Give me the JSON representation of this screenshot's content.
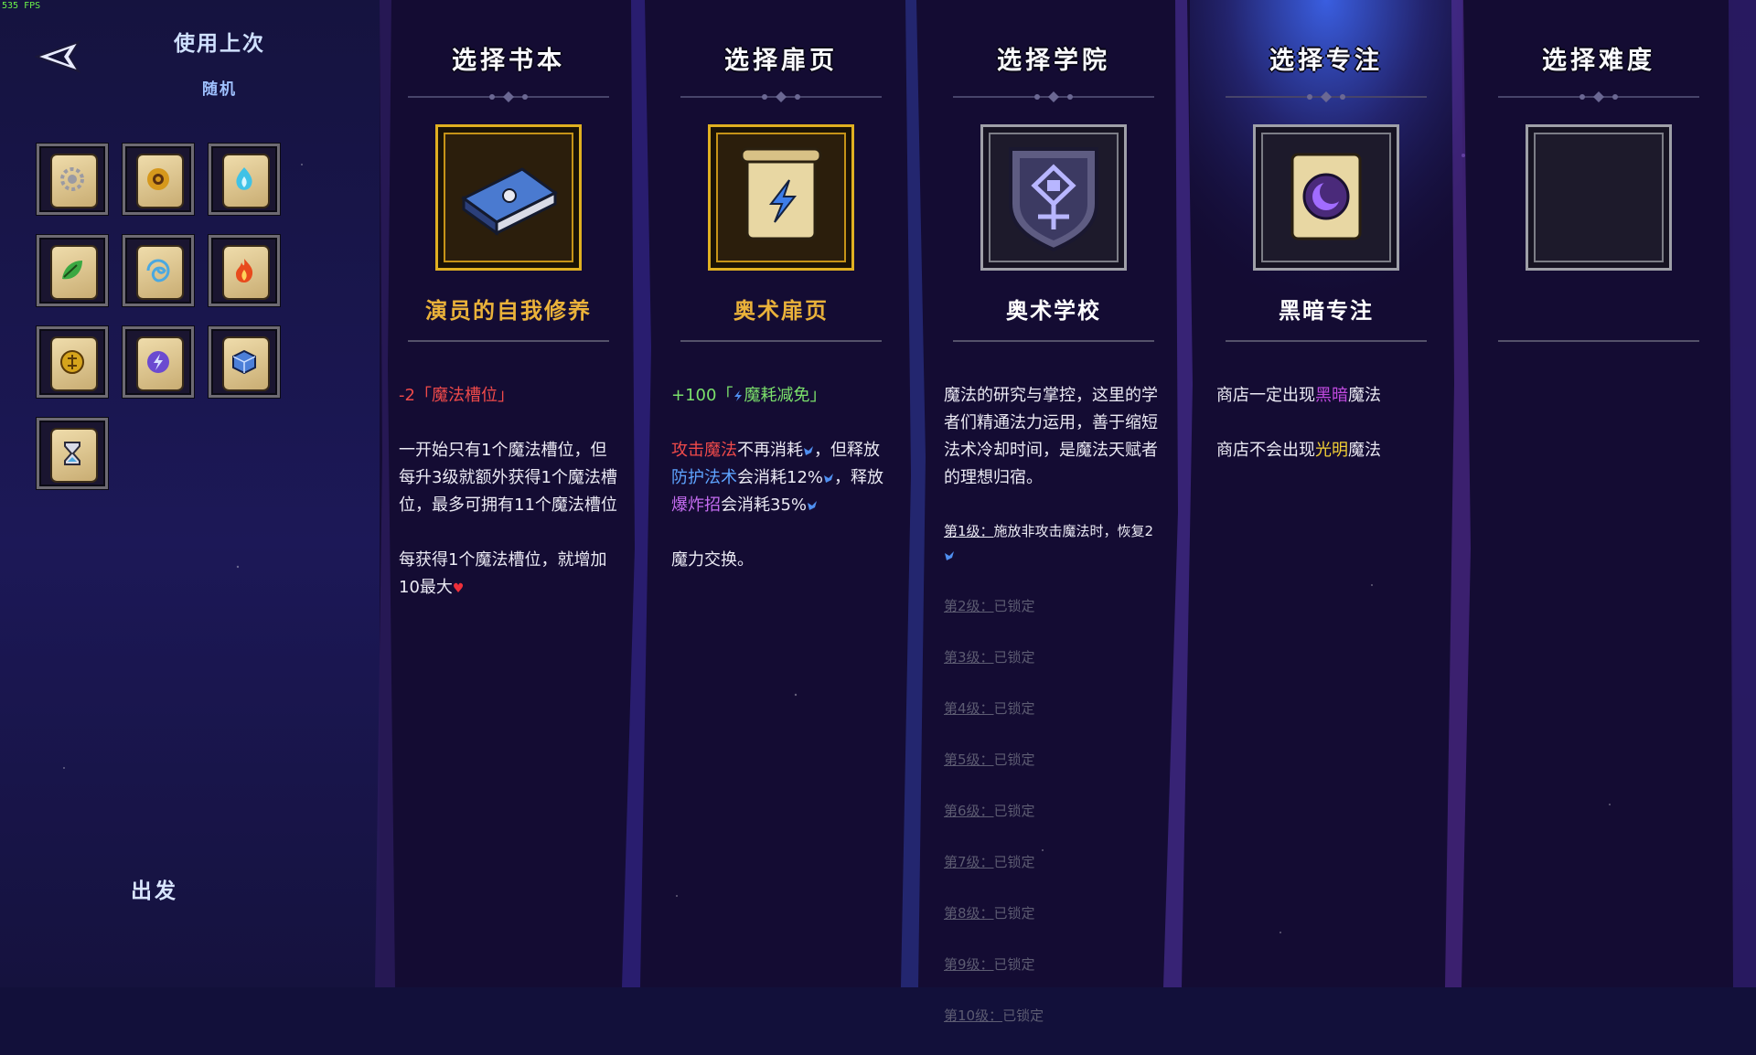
{
  "fps": "535 FPS",
  "left": {
    "use_last": "使用上次",
    "random": "随机",
    "go": "出发",
    "slots": [
      {
        "icon": "gear-orb-icon",
        "color": "#9a9aa3"
      },
      {
        "icon": "sun-disc-icon",
        "color": "#d6981c"
      },
      {
        "icon": "water-flame-icon",
        "color": "#3fc2e6"
      },
      {
        "icon": "leaf-icon",
        "color": "#3aa842"
      },
      {
        "icon": "whirlwind-icon",
        "color": "#4aa8e0"
      },
      {
        "icon": "fire-icon",
        "color": "#e84a1c"
      },
      {
        "icon": "golden-coin-icon",
        "color": "#d6a41c"
      },
      {
        "icon": "arcane-bolt-icon",
        "color": "#6b4ad0"
      },
      {
        "icon": "cube-icon",
        "color": "#4c7fd8"
      },
      {
        "icon": "hourglass-icon",
        "color": "#4aa8e0"
      }
    ]
  },
  "columns": [
    {
      "title": "选择书本",
      "name": "演员的自我修养",
      "name_color": "#eab23a",
      "frame": "gold",
      "icon": "spellbook-icon",
      "d1_a": "-2「魔法槽位」",
      "d2": "一开始只有1个魔法槽位，但每升3级就额外获得1个魔法槽位，最多可拥有11个魔法槽位",
      "d3": "每获得1个魔法槽位，就增加10最大",
      "heart": "♥"
    },
    {
      "title": "选择扉页",
      "name": "奥术扉页",
      "name_color": "#eab23a",
      "frame": "gold",
      "icon": "arcane-page-icon",
      "d1_a": "+100「",
      "d1_b": "魔耗减免」",
      "d2_a": "攻击魔法",
      "d2_b": "不再消耗",
      "d2_c": "，但释放",
      "d2_d": "防护法术",
      "d2_e": "会消耗12%",
      "d2_f": "，释放",
      "d2_g": "爆炸招",
      "d2_h": "会消耗35%",
      "d3": "魔力交换。"
    },
    {
      "title": "选择学院",
      "name": "奥术学校",
      "name_color": "#ffffff",
      "frame": "grey",
      "icon": "arcane-shield-icon",
      "d1": "魔法的研究与掌控，这里的学者们精通法力运用，善于缩短法术冷却时间，是魔法天赋者的理想归宿。",
      "levels": [
        {
          "k": "第1级：",
          "v": "施放非攻击魔法时，恢复2",
          "locked": false
        },
        {
          "k": "第2级：",
          "v": "已锁定",
          "locked": true
        },
        {
          "k": "第3级：",
          "v": "已锁定",
          "locked": true
        },
        {
          "k": "第4级：",
          "v": "已锁定",
          "locked": true
        },
        {
          "k": "第5级：",
          "v": "已锁定",
          "locked": true
        },
        {
          "k": "第6级：",
          "v": "已锁定",
          "locked": true
        },
        {
          "k": "第7级：",
          "v": "已锁定",
          "locked": true
        },
        {
          "k": "第8级：",
          "v": "已锁定",
          "locked": true
        },
        {
          "k": "第9级：",
          "v": "已锁定",
          "locked": true
        },
        {
          "k": "第10级：",
          "v": "已锁定",
          "locked": true
        }
      ]
    },
    {
      "title": "选择专注",
      "name": "黑暗专注",
      "name_color": "#ffffff",
      "frame": "grey",
      "icon": "dark-moon-icon",
      "d1_a": "商店一定出现",
      "d1_b": "黑暗",
      "d1_c": "魔法",
      "d2_a": "商店不会出现",
      "d2_b": "光明",
      "d2_c": "魔法"
    },
    {
      "title": "选择难度",
      "name": "",
      "frame": "grey",
      "icon": "empty-slot"
    }
  ]
}
